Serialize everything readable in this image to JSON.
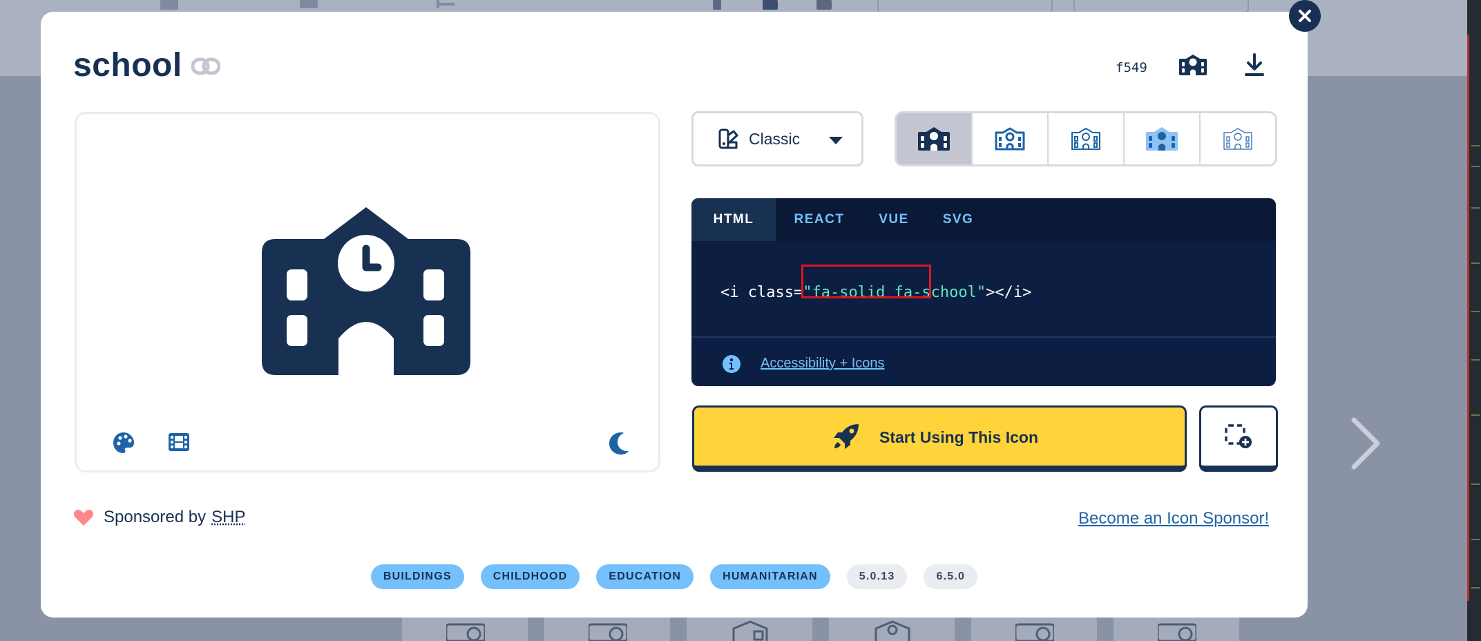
{
  "page": {
    "next_label": "next"
  },
  "icon": {
    "name": "school",
    "unicode": "f549"
  },
  "style_dropdown": {
    "selected": "Classic"
  },
  "variants": [
    {
      "name": "solid"
    },
    {
      "name": "regular"
    },
    {
      "name": "light"
    },
    {
      "name": "duotone"
    },
    {
      "name": "thin"
    }
  ],
  "code": {
    "tabs": [
      "HTML",
      "REACT",
      "VUE",
      "SVG"
    ],
    "active_tab": "HTML",
    "prefix": "<i class=",
    "classes": "\"fa-solid fa-school\"",
    "suffix": "></i>",
    "accessibility_link": "Accessibility + Icons"
  },
  "actions": {
    "start_label": "Start Using This Icon"
  },
  "sponsor": {
    "text": "Sponsored by",
    "brand": "SHP",
    "become": "Become an Icon Sponsor!"
  },
  "tags": [
    "BUILDINGS",
    "CHILDHOOD",
    "EDUCATION",
    "HUMANITARIAN"
  ],
  "versions": [
    "5.0.13",
    "6.5.0"
  ],
  "colors": {
    "navy": "#183153",
    "code_bg": "#0c1f42",
    "accent_blue": "#74c0fc",
    "link_blue": "#1e63a6",
    "yellow": "#ffd43b",
    "heart": "#ff8787",
    "highlight_red": "#e0141e"
  }
}
